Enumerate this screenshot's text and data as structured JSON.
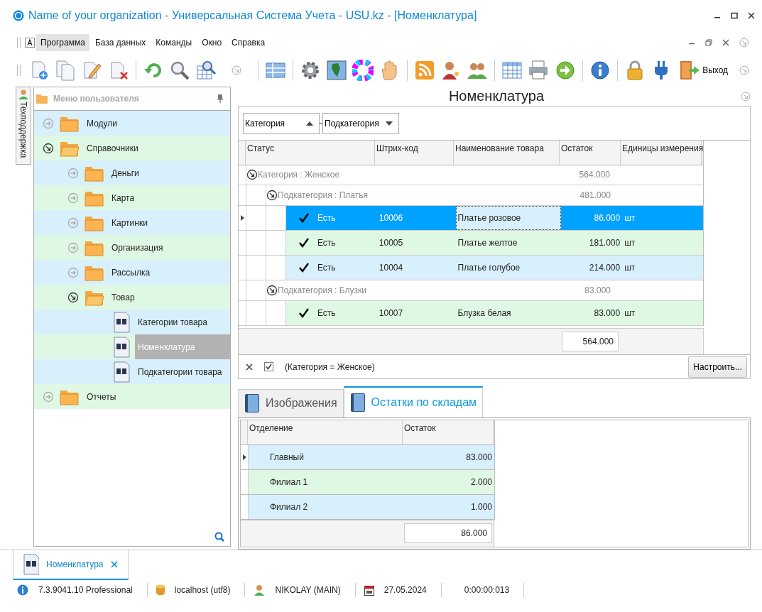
{
  "window": {
    "title": "Name of your organization - Универсальная Система Учета - USU.kz - [Номенклатура]"
  },
  "menu": [
    {
      "label": "Программа",
      "selected": true
    },
    {
      "label": "База данных",
      "selected": false
    },
    {
      "label": "Команды",
      "selected": false
    },
    {
      "label": "Окно",
      "selected": false
    },
    {
      "label": "Справка",
      "selected": false
    }
  ],
  "toolbar": {
    "exit_label": "Выход"
  },
  "side_tab": {
    "label": "Техподдержка"
  },
  "user_menu": {
    "title": "Меню пользователя",
    "items": [
      {
        "label": "Модули",
        "kind": "folder",
        "expanded": false,
        "selected": false
      },
      {
        "label": "Справочники",
        "kind": "folder",
        "expanded": true,
        "selected": false,
        "children": [
          {
            "label": "Деньги",
            "kind": "folder",
            "expanded": false,
            "selected": false
          },
          {
            "label": "Карта",
            "kind": "folder",
            "expanded": false,
            "selected": false
          },
          {
            "label": "Картинки",
            "kind": "folder",
            "expanded": false,
            "selected": false
          },
          {
            "label": "Организация",
            "kind": "folder",
            "expanded": false,
            "selected": false
          },
          {
            "label": "Рассылка",
            "kind": "folder",
            "expanded": false,
            "selected": false
          },
          {
            "label": "Товар",
            "kind": "folder",
            "expanded": true,
            "selected": false,
            "children": [
              {
                "label": "Категории товара",
                "kind": "document",
                "selected": false
              },
              {
                "label": "Номенклатура",
                "kind": "document",
                "selected": true
              },
              {
                "label": "Подкатегории товара",
                "kind": "document",
                "selected": false
              }
            ]
          }
        ]
      },
      {
        "label": "Отчеты",
        "kind": "folder",
        "expanded": false,
        "selected": false
      }
    ]
  },
  "content": {
    "title": "Номенклатура",
    "grouping": [
      {
        "label": "Категория",
        "descending": false
      },
      {
        "label": "Подкатегория",
        "descending": true
      }
    ],
    "grid": {
      "columns": [
        "Статус",
        "Штрих-код",
        "Наименование товара",
        "Остаток",
        "Единицы измерения"
      ],
      "groups": [
        {
          "label": "Категория : Женское",
          "total": "564.000",
          "expanded": true,
          "groups": [
            {
              "label": "Подкатегория : Платья",
              "total": "481.000",
              "expanded": true,
              "rows": [
                {
                  "checked": true,
                  "status": "Есть",
                  "barcode": "10006",
                  "name": "Платье розовое",
                  "quantity": "86.000",
                  "unit": "шт",
                  "selected": true
                },
                {
                  "checked": true,
                  "status": "Есть",
                  "barcode": "10005",
                  "name": "Платье желтое",
                  "quantity": "181.000",
                  "unit": "шт",
                  "selected": false
                },
                {
                  "checked": true,
                  "status": "Есть",
                  "barcode": "10004",
                  "name": "Платье голубое",
                  "quantity": "214.000",
                  "unit": "шт",
                  "selected": false
                }
              ]
            },
            {
              "label": "Подкатегория : Блузки",
              "total": "83.000",
              "expanded": true,
              "rows": [
                {
                  "checked": true,
                  "status": "Есть",
                  "barcode": "10007",
                  "name": "Блузка белая",
                  "quantity": "83.000",
                  "unit": "шт",
                  "selected": false
                }
              ]
            }
          ]
        }
      ],
      "total": "564.000"
    },
    "filter": {
      "enabled": true,
      "text": "(Категория = Женское)"
    },
    "configure_button": "Настроить..."
  },
  "detail_tabs": [
    {
      "label": "Изображения",
      "selected": false
    },
    {
      "label": "Остатки по складам",
      "selected": true
    }
  ],
  "stock": {
    "columns": [
      "Отделение",
      "Остаток"
    ],
    "rows": [
      {
        "branch": "Главный",
        "quantity": "83.000",
        "selected": true
      },
      {
        "branch": "Филиал 1",
        "quantity": "2.000",
        "selected": false
      },
      {
        "branch": "Филиал 2",
        "quantity": "1.000",
        "selected": false
      }
    ],
    "total": "86.000"
  },
  "doc_tabs": [
    {
      "label": "Номенклатура",
      "selected": true
    }
  ],
  "status_bar": [
    {
      "kind": "version",
      "text": "7.3.9041.10 Professional"
    },
    {
      "kind": "database",
      "text": "localhost (utf8)"
    },
    {
      "kind": "user",
      "text": "NIKOLAY (MAIN)"
    },
    {
      "kind": "date",
      "text": "27.05.2024"
    },
    {
      "kind": "timer",
      "text": "0:00:00:013"
    }
  ]
}
